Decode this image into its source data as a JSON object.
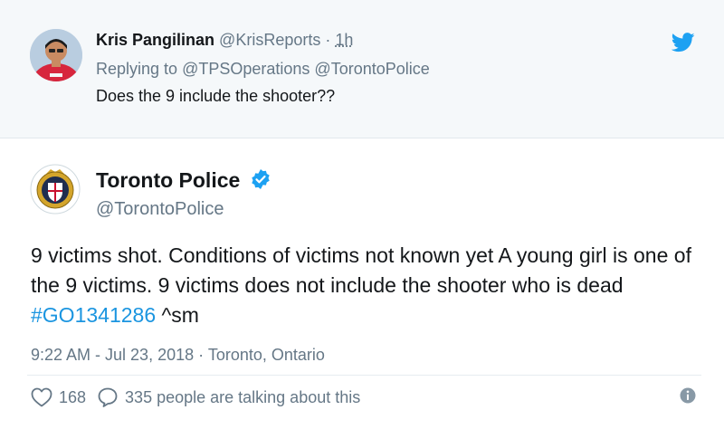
{
  "reply_tweet": {
    "author_name": "Kris Pangilinan",
    "author_handle": "@KrisReports",
    "separator": "·",
    "time": "1h",
    "replying_prefix": "Replying to",
    "mentions": [
      "@TPSOperations",
      "@TorontoPolice"
    ],
    "text": "Does the 9 include the shooter??",
    "avatar_icon": "person-red-shirt-avatar",
    "avatar_shirt_color": "#d7263d"
  },
  "twitter_icon": "twitter-bird-icon",
  "brand_color": "#1da1f2",
  "main_tweet": {
    "author_name": "Toronto Police",
    "author_handle": "@TorontoPolice",
    "verified_icon": "verified-badge-icon",
    "avatar_icon": "police-crest-avatar",
    "text_part1": "9 victims shot. Conditions of victims not known yet A young girl is one of the 9 victims. 9 victims does not include the shooter who is dead ",
    "hashtag": "#GO1341286",
    "text_part2": " ^sm",
    "timestamp": "9:22 AM - Jul 23, 2018",
    "meta_separator": "·",
    "location": "Toronto, Ontario",
    "likes": "168",
    "talking": "335 people are talking about this",
    "link_color": "#1b95e0"
  }
}
